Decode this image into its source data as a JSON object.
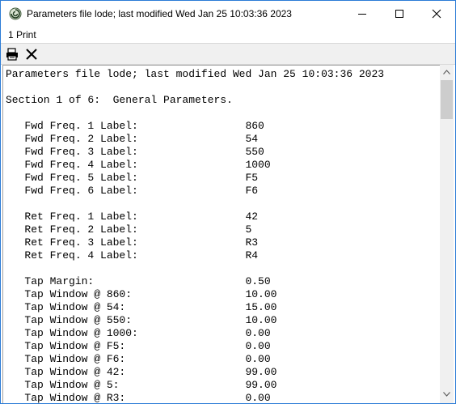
{
  "window": {
    "title": "Parameters file lode; last modified Wed Jan 25 10:03:36 2023",
    "icon": "app-swirl-icon"
  },
  "menu": {
    "items": [
      {
        "label": "1 Print"
      }
    ]
  },
  "toolbar": {
    "buttons": [
      {
        "icon": "printer-icon"
      },
      {
        "icon": "close-x-icon"
      }
    ]
  },
  "report": {
    "lines": [
      "Parameters file lode; last modified Wed Jan 25 10:03:36 2023",
      "",
      "Section 1 of 6:  General Parameters.",
      "",
      "   Fwd Freq. 1 Label:                 860",
      "   Fwd Freq. 2 Label:                 54",
      "   Fwd Freq. 3 Label:                 550",
      "   Fwd Freq. 4 Label:                 1000",
      "   Fwd Freq. 5 Label:                 F5",
      "   Fwd Freq. 6 Label:                 F6",
      "",
      "   Ret Freq. 1 Label:                 42",
      "   Ret Freq. 2 Label:                 5",
      "   Ret Freq. 3 Label:                 R3",
      "   Ret Freq. 4 Label:                 R4",
      "",
      "   Tap Margin:                        0.50",
      "   Tap Window @ 860:                  10.00",
      "   Tap Window @ 54:                   15.00",
      "   Tap Window @ 550:                  10.00",
      "   Tap Window @ 1000:                 0.00",
      "   Tap Window @ F5:                   0.00",
      "   Tap Window @ F6:                   0.00",
      "   Tap Window @ 42:                   99.00",
      "   Tap Window @ 5:                    99.00",
      "   Tap Window @ R3:                   0.00"
    ]
  }
}
